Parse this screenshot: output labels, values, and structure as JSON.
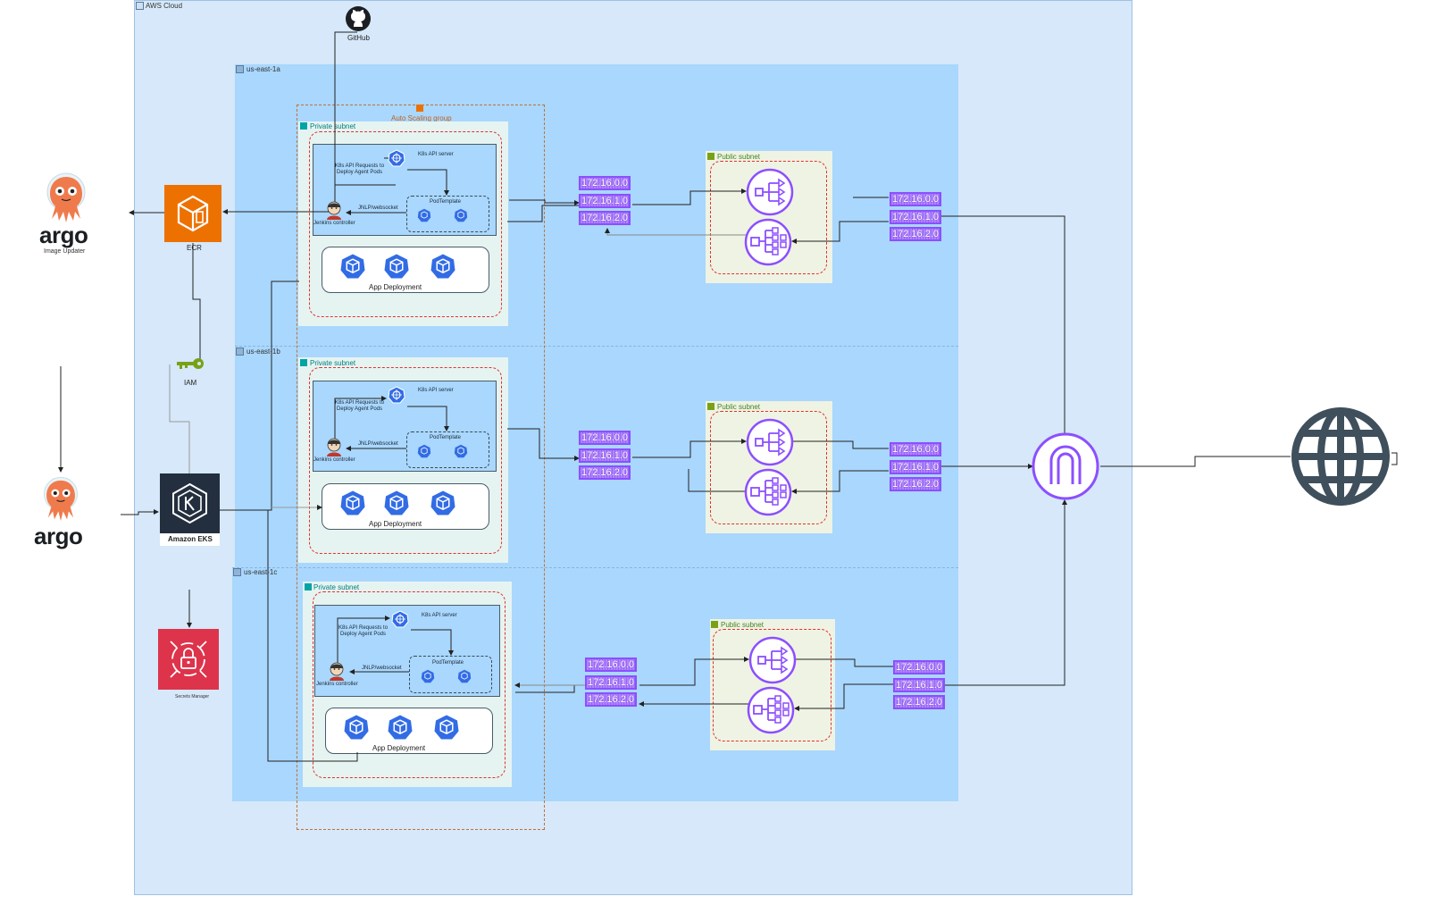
{
  "labels": {
    "aws_cloud": "AWS Cloud",
    "github": "GitHub",
    "az_a": "us-east-1a",
    "az_b": "us-east-1b",
    "az_c": "us-east-1c",
    "asg": "Auto Scaling group",
    "private_subnet": "Private subnet",
    "public_subnet": "Public subnet",
    "k8s_api": "K8s API server",
    "requests": "K8s API Requests to\nDeploy Agent Pods",
    "jnlp": "JNLP/websocket",
    "pod_template": "PodTemplate",
    "jenkins": "Jenkins controller",
    "app_deployment": "App Deployment",
    "ecr": "ECR",
    "iam": "IAM",
    "eks": "Amazon EKS",
    "secrets_manager": "Secrets Manager",
    "argo_word": "argo",
    "image_updater": "Image Updater"
  },
  "cidrs": [
    "172.16.0.0",
    "172.16.1.0",
    "172.16.2.0"
  ],
  "colors": {
    "cloud": "#d6e8f9",
    "az": "#a9d7fd",
    "private_subnet": "#e6f4f1",
    "public_subnet": "#eff3e3",
    "accent_purple": "#8c4fff",
    "ecr_orange": "#ed7100",
    "secrets_red": "#dd344c",
    "eks_dark": "#232f3e"
  }
}
